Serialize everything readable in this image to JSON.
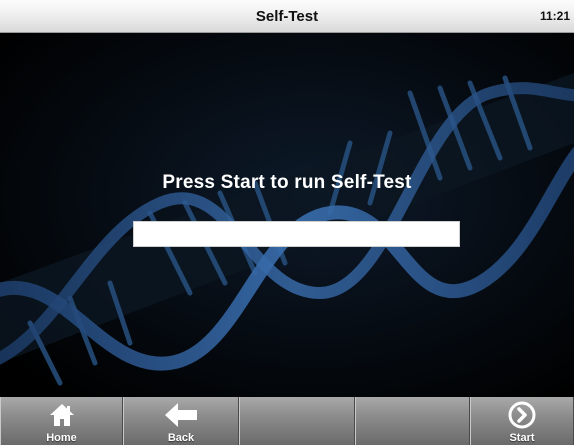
{
  "window": {
    "title": "Self-Test",
    "clock": "11:21"
  },
  "main": {
    "prompt": "Press Start to run Self-Test",
    "progress": 0,
    "background": "dna-helix-image"
  },
  "toolbar": {
    "buttons": [
      {
        "label": "Home",
        "icon": "home-icon"
      },
      {
        "label": "Back",
        "icon": "back-arrow-icon"
      },
      {
        "label": "",
        "icon": ""
      },
      {
        "label": "",
        "icon": ""
      },
      {
        "label": "Start",
        "icon": "start-arrow-icon"
      }
    ]
  },
  "colors": {
    "background": "#000000",
    "helix": "#2f5f9a",
    "toolbar": "#8c8c8c",
    "titlebar": "#e8e8e8"
  }
}
